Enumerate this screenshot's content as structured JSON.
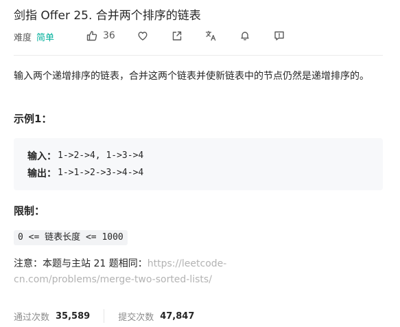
{
  "problem": {
    "title": "剑指 Offer 25. 合并两个排序的链表",
    "difficulty_label": "难度",
    "difficulty": "简单",
    "likes": "36",
    "icons": [
      "thumbs-up-icon",
      "heart-icon",
      "share-icon",
      "translate-icon",
      "bell-icon",
      "feedback-icon"
    ]
  },
  "description": "输入两个递增排序的链表，合并这两个链表并使新链表中的节点仍然是递增排序的。",
  "example": {
    "heading": "示例1：",
    "input_label": "输入：",
    "input_value": "1->2->4, 1->3->4",
    "output_label": "输出：",
    "output_value": "1->1->2->3->4->4"
  },
  "limits": {
    "heading": "限制：",
    "code": "0 <= 链表长度 <= 1000"
  },
  "note": {
    "prefix": "注意：本题与主站 21 题相同：",
    "link_line1": "https://leetcode-",
    "link_line2": "cn.com/problems/merge-two-sorted-lists/"
  },
  "stats": {
    "passed_label": "通过次数",
    "passed_value": "35,589",
    "submitted_label": "提交次数",
    "submitted_value": "47,847"
  },
  "colors": {
    "easy": "#00af9b",
    "link": "#b3b3b3",
    "code_bg": "#f7f8fa"
  }
}
